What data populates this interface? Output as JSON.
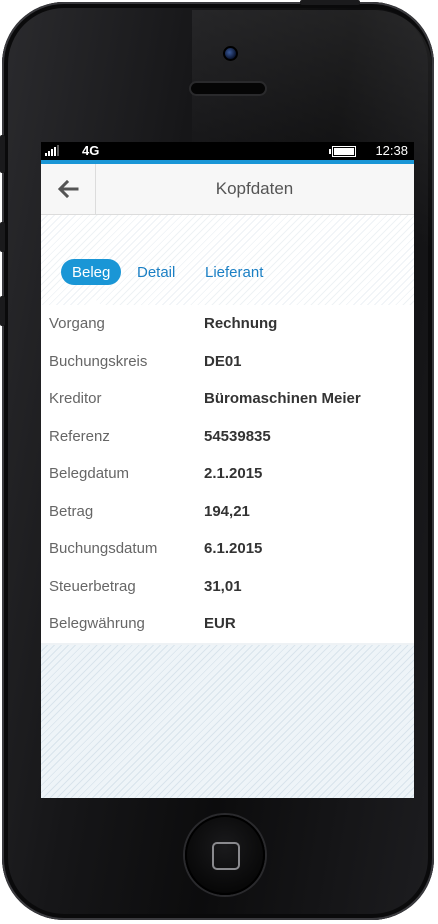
{
  "status": {
    "network": "4G",
    "time": "12:38"
  },
  "header": {
    "title": "Kopfdaten"
  },
  "tabs": [
    {
      "label": "Beleg"
    },
    {
      "label": "Detail"
    },
    {
      "label": "Lieferant"
    }
  ],
  "details": [
    {
      "label": "Vorgang",
      "value": "Rechnung"
    },
    {
      "label": "Buchungskreis",
      "value": "DE01"
    },
    {
      "label": "Kreditor",
      "value": "Büromaschinen Meier"
    },
    {
      "label": "Referenz",
      "value": "54539835"
    },
    {
      "label": "Belegdatum",
      "value": "2.1.2015"
    },
    {
      "label": "Betrag",
      "value": "194,21"
    },
    {
      "label": "Buchungsdatum",
      "value": "6.1.2015"
    },
    {
      "label": "Steuerbetrag",
      "value": "31,01"
    },
    {
      "label": "Belegwährung",
      "value": "EUR"
    }
  ],
  "icons": {
    "back": "arrow-left-icon",
    "signal": "signal-icon",
    "battery": "battery-icon",
    "home": "home-button"
  },
  "colors": {
    "accent": "#1a96d6",
    "link": "#1a7fc4"
  }
}
